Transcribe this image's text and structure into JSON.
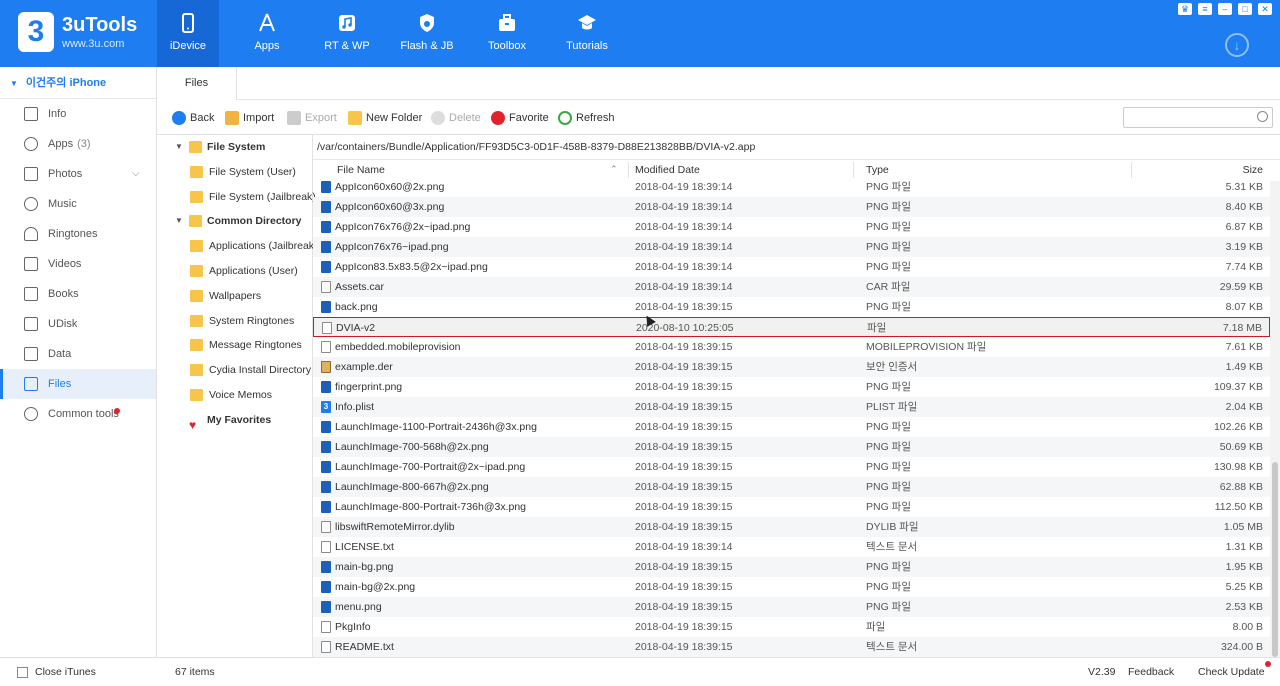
{
  "app": {
    "name": "3uTools",
    "url": "www.3u.com",
    "logo": "3"
  },
  "nav": [
    {
      "label": "iDevice",
      "icon": "phone-icon"
    },
    {
      "label": "Apps",
      "icon": "appstore-icon"
    },
    {
      "label": "RT & WP",
      "icon": "music-icon"
    },
    {
      "label": "Flash & JB",
      "icon": "flash-icon"
    },
    {
      "label": "Toolbox",
      "icon": "toolbox-icon"
    },
    {
      "label": "Tutorials",
      "icon": "graduation-cap-icon"
    }
  ],
  "device": {
    "name": "이건주의 iPhone"
  },
  "sidebar": [
    {
      "label": "Info",
      "count": ""
    },
    {
      "label": "Apps",
      "count": "(3)"
    },
    {
      "label": "Photos",
      "count": ""
    },
    {
      "label": "Music",
      "count": ""
    },
    {
      "label": "Ringtones",
      "count": ""
    },
    {
      "label": "Videos",
      "count": ""
    },
    {
      "label": "Books",
      "count": ""
    },
    {
      "label": "UDisk",
      "count": ""
    },
    {
      "label": "Data",
      "count": ""
    },
    {
      "label": "Files",
      "count": ""
    },
    {
      "label": "Common tools",
      "count": ""
    }
  ],
  "files_tab": "Files",
  "toolbar": {
    "back": "Back",
    "import": "Import",
    "export": "Export",
    "new_folder": "New Folder",
    "delete": "Delete",
    "favorite": "Favorite",
    "refresh": "Refresh",
    "search_placeholder": ""
  },
  "tree": {
    "file_system": "File System",
    "fs_user": "File System (User)",
    "fs_jailbreak": "File System (Jailbreak)",
    "common_directory": "Common Directory",
    "children": [
      "Applications (Jailbreak)",
      "Applications (User)",
      "Wallpapers",
      "System Ringtones",
      "Message Ringtones",
      "Cydia Install Directory",
      "Voice Memos"
    ],
    "favorites": "My Favorites"
  },
  "path": "/var/containers/Bundle/Application/FF93D5C3-0D1F-458B-8379-D88E213828BB/DVIA-v2.app",
  "columns": {
    "name": "File Name",
    "date": "Modified Date",
    "type": "Type",
    "size": "Size"
  },
  "files": [
    {
      "name": "AppIcon60x60@2x.png",
      "date": "2018-04-19 18:39:14",
      "type": "PNG 파일",
      "size": "5.31 KB",
      "icon": "png"
    },
    {
      "name": "AppIcon60x60@3x.png",
      "date": "2018-04-19 18:39:14",
      "type": "PNG 파일",
      "size": "8.40 KB",
      "icon": "png"
    },
    {
      "name": "AppIcon76x76@2x~ipad.png",
      "date": "2018-04-19 18:39:14",
      "type": "PNG 파일",
      "size": "6.87 KB",
      "icon": "png"
    },
    {
      "name": "AppIcon76x76~ipad.png",
      "date": "2018-04-19 18:39:14",
      "type": "PNG 파일",
      "size": "3.19 KB",
      "icon": "png"
    },
    {
      "name": "AppIcon83.5x83.5@2x~ipad.png",
      "date": "2018-04-19 18:39:14",
      "type": "PNG 파일",
      "size": "7.74 KB",
      "icon": "png"
    },
    {
      "name": "Assets.car",
      "date": "2018-04-19 18:39:14",
      "type": "CAR 파일",
      "size": "29.59 KB",
      "icon": "doc"
    },
    {
      "name": "back.png",
      "date": "2018-04-19 18:39:15",
      "type": "PNG 파일",
      "size": "8.07 KB",
      "icon": "png"
    },
    {
      "name": "DVIA-v2",
      "date": "2020-08-10 10:25:05",
      "type": "파일",
      "size": "7.18 MB",
      "icon": "doc",
      "selected": true
    },
    {
      "name": "embedded.mobileprovision",
      "date": "2018-04-19 18:39:15",
      "type": "MOBILEPROVISION 파일",
      "size": "7.61 KB",
      "icon": "doc"
    },
    {
      "name": "example.der",
      "date": "2018-04-19 18:39:15",
      "type": "보안 인증서",
      "size": "1.49 KB",
      "icon": "der"
    },
    {
      "name": "fingerprint.png",
      "date": "2018-04-19 18:39:15",
      "type": "PNG 파일",
      "size": "109.37 KB",
      "icon": "png"
    },
    {
      "name": "Info.plist",
      "date": "2018-04-19 18:39:15",
      "type": "PLIST 파일",
      "size": "2.04 KB",
      "icon": "plist"
    },
    {
      "name": "LaunchImage-1100-Portrait-2436h@3x.png",
      "date": "2018-04-19 18:39:15",
      "type": "PNG 파일",
      "size": "102.26 KB",
      "icon": "png"
    },
    {
      "name": "LaunchImage-700-568h@2x.png",
      "date": "2018-04-19 18:39:15",
      "type": "PNG 파일",
      "size": "50.69 KB",
      "icon": "png"
    },
    {
      "name": "LaunchImage-700-Portrait@2x~ipad.png",
      "date": "2018-04-19 18:39:15",
      "type": "PNG 파일",
      "size": "130.98 KB",
      "icon": "png"
    },
    {
      "name": "LaunchImage-800-667h@2x.png",
      "date": "2018-04-19 18:39:15",
      "type": "PNG 파일",
      "size": "62.88 KB",
      "icon": "png"
    },
    {
      "name": "LaunchImage-800-Portrait-736h@3x.png",
      "date": "2018-04-19 18:39:15",
      "type": "PNG 파일",
      "size": "112.50 KB",
      "icon": "png"
    },
    {
      "name": "libswiftRemoteMirror.dylib",
      "date": "2018-04-19 18:39:15",
      "type": "DYLIB 파일",
      "size": "1.05 MB",
      "icon": "doc"
    },
    {
      "name": "LICENSE.txt",
      "date": "2018-04-19 18:39:14",
      "type": "텍스트 문서",
      "size": "1.31 KB",
      "icon": "doc"
    },
    {
      "name": "main-bg.png",
      "date": "2018-04-19 18:39:15",
      "type": "PNG 파일",
      "size": "1.95 KB",
      "icon": "png"
    },
    {
      "name": "main-bg@2x.png",
      "date": "2018-04-19 18:39:15",
      "type": "PNG 파일",
      "size": "5.25 KB",
      "icon": "png"
    },
    {
      "name": "menu.png",
      "date": "2018-04-19 18:39:15",
      "type": "PNG 파일",
      "size": "2.53 KB",
      "icon": "png"
    },
    {
      "name": "PkgInfo",
      "date": "2018-04-19 18:39:15",
      "type": "파일",
      "size": "8.00 B",
      "icon": "doc"
    },
    {
      "name": "README.txt",
      "date": "2018-04-19 18:39:15",
      "type": "텍스트 문서",
      "size": "324.00 B",
      "icon": "doc"
    }
  ],
  "status": {
    "close_itunes": "Close iTunes",
    "items": "67 items",
    "version": "V2.39",
    "feedback": "Feedback",
    "check_update": "Check Update"
  },
  "colors": {
    "accent": "#1e7df0",
    "selection_border": "#d0191f",
    "badge": "#e0242e"
  }
}
